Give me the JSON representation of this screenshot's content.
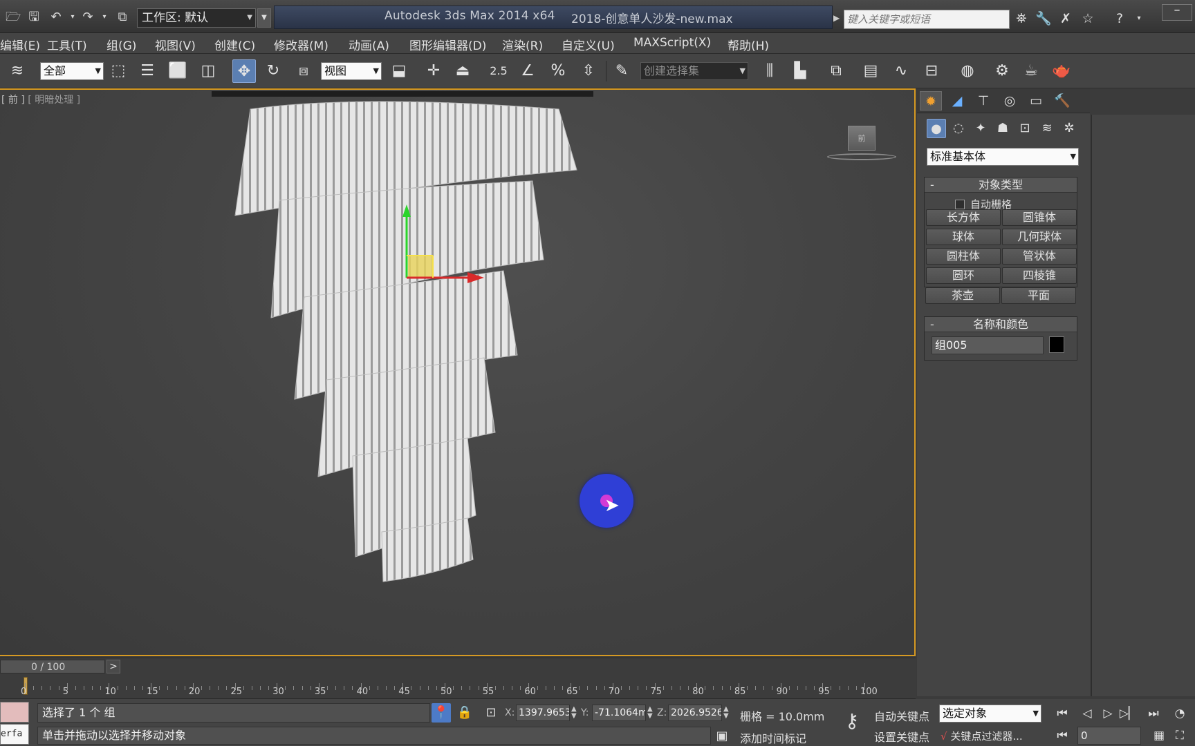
{
  "title_bar": {
    "workspace": "工作区: 默认",
    "app_title": "Autodesk 3ds Max  2014 x64",
    "file_title": "2018-创意单人沙发-new.max",
    "search_placeholder": "键入关键字或短语"
  },
  "menu": [
    "编辑(E)",
    "工具(T)",
    "组(G)",
    "视图(V)",
    "创建(C)",
    "修改器(M)",
    "动画(A)",
    "图形编辑器(D)",
    "渲染(R)",
    "自定义(U)",
    "MAXScript(X)",
    "帮助(H)"
  ],
  "toolbar": {
    "selection_filter": "全部",
    "reference_coord": "视图",
    "snap_angle_label": "2.5",
    "named_selection_placeholder": "创建选择集"
  },
  "viewport": {
    "label_view": "[ 前 ]",
    "label_shading": "[ 明暗处理 ]",
    "viewcube_face": "前"
  },
  "command_panel": {
    "category": "标准基本体",
    "object_type_title": "对象类型",
    "autogrid_label": "自动栅格",
    "object_buttons": [
      "长方体",
      "圆锥体",
      "球体",
      "几何球体",
      "圆柱体",
      "管状体",
      "圆环",
      "四棱锥",
      "茶壶",
      "平面"
    ],
    "name_color_title": "名称和颜色",
    "object_name": "组005",
    "object_color": "#000000"
  },
  "timeline": {
    "frame_counter": "0 / 100",
    "next_button": ">",
    "tick_labels": [
      "0",
      "5",
      "10",
      "15",
      "20",
      "25",
      "30",
      "35",
      "40",
      "45",
      "50",
      "55",
      "60",
      "65",
      "70",
      "75",
      "80",
      "85",
      "90",
      "95",
      "100"
    ]
  },
  "status": {
    "listener_text": "erfa",
    "selection_status": "选择了 1 个 组",
    "prompt": "单击并拖动以选择并移动对象",
    "x_label": "X:",
    "x_value": "1397.9653",
    "y_label": "Y:",
    "y_value": "-71.1064m",
    "z_label": "Z:",
    "z_value": "2026.9526",
    "grid": "栅格 = 10.0mm",
    "add_time_tag": "添加时间标记",
    "auto_key": "自动关键点",
    "set_key": "设置关键点",
    "key_mode": "选定对象",
    "key_filters": "关键点过滤器...",
    "current_frame": "0"
  },
  "colors": {
    "viewport_border": "#d79a22",
    "active_tool": "#5b7fb2",
    "cursor_highlight": "#2f3fd6"
  }
}
